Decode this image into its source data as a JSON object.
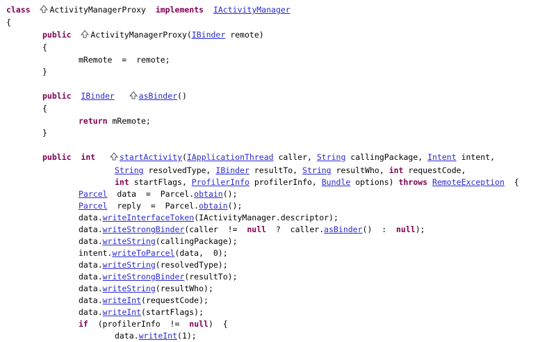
{
  "code": {
    "l1": {
      "kw_class": "class",
      "name": "ActivityManagerProxy",
      "kw_impl": "implements",
      "iface": "IActivityManager"
    },
    "l2": {
      "brace": "{"
    },
    "l3": {
      "kw_public": "public",
      "name": "ActivityManagerProxy(",
      "type": "IBinder",
      "tail": " remote)"
    },
    "l4": {
      "brace": "{"
    },
    "l5": {
      "text": "mRemote  =  remote;"
    },
    "l6": {
      "brace": "}"
    },
    "l7": {
      "kw_public": "public",
      "type": "IBinder",
      "method": "asBinder",
      "tail": "()"
    },
    "l8": {
      "brace": "{"
    },
    "l9": {
      "kw_return": "return",
      "tail": " mRemote;"
    },
    "l10": {
      "brace": "}"
    },
    "l11": {
      "kw_public": "public",
      "kw_int": "int",
      "method": "startActivity",
      "paren": "(",
      "t1": "IApplicationThread",
      "a1": " caller, ",
      "t2": "String",
      "a2": " callingPackage, ",
      "t3": "Intent",
      "a3": " intent,"
    },
    "l12": {
      "t1": "String",
      "a1": " resolvedType, ",
      "t2": "IBinder",
      "a2": " resultTo, ",
      "t3": "String",
      "a3": " resultWho, ",
      "kw_int": "int",
      "a4": " requestCode,"
    },
    "l13": {
      "kw_int": "int",
      "a1": " startFlags, ",
      "t2": "ProfilerInfo",
      "a2": " profilerInfo, ",
      "t3": "Bundle",
      "a3": " options) ",
      "kw_throws": "throws",
      "t4": "RemoteException",
      "a4": "  {"
    },
    "l14": {
      "type": "Parcel",
      "tail": "  data  =  Parcel.",
      "m": "obtain",
      "end": "();"
    },
    "l15": {
      "type": "Parcel",
      "tail": "  reply  =  Parcel.",
      "m": "obtain",
      "end": "();"
    },
    "l16": {
      "pre": "data.",
      "m": "writeInterfaceToken",
      "end": "(IActivityManager.descriptor);"
    },
    "l17": {
      "pre": "data.",
      "m": "writeStrongBinder",
      "mid": "(caller  !=  ",
      "kw_null": "null",
      "q": "  ?  caller.",
      "m2": "asBinder",
      "c": "()  :  ",
      "kw_null2": "null",
      "end": ");"
    },
    "l18": {
      "pre": "data.",
      "m": "writeString",
      "end": "(callingPackage);"
    },
    "l19": {
      "pre": "intent.",
      "m": "writeToParcel",
      "end": "(data,  0);"
    },
    "l20": {
      "pre": "data.",
      "m": "writeString",
      "end": "(resolvedType);"
    },
    "l21": {
      "pre": "data.",
      "m": "writeStrongBinder",
      "end": "(resultTo);"
    },
    "l22": {
      "pre": "data.",
      "m": "writeString",
      "end": "(resultWho);"
    },
    "l23": {
      "pre": "data.",
      "m": "writeInt",
      "end": "(requestCode);"
    },
    "l24": {
      "pre": "data.",
      "m": "writeInt",
      "end": "(startFlags);"
    },
    "l25": {
      "kw_if": "if",
      "mid": "  (profilerInfo  !=  ",
      "kw_null": "null",
      "end": ")  {"
    },
    "l26": {
      "pre": "data.",
      "m": "writeInt",
      "end": "(1);"
    }
  },
  "colors": {
    "keyword": "#7f0055",
    "link": "#2a2acc"
  },
  "icons": {
    "override": "override-triangle-icon"
  }
}
